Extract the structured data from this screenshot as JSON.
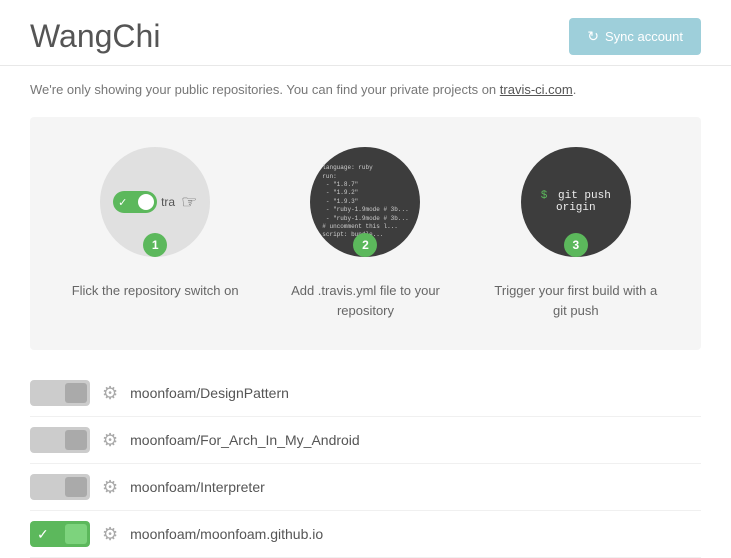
{
  "header": {
    "title": "WangChi",
    "sync_button_label": "Sync account"
  },
  "subheader": {
    "text_before": "We're only showing your public repositories. You can find your private projects on ",
    "link_text": "travis-ci.com",
    "link_href": "https://travis-ci.com",
    "text_after": "."
  },
  "steps": [
    {
      "number": "1",
      "label": "Flick the repository switch on",
      "type": "toggle"
    },
    {
      "number": "2",
      "label": "Add .travis.yml file to your repository",
      "type": "code"
    },
    {
      "number": "3",
      "label": "Trigger your first build with a git push",
      "type": "terminal"
    }
  ],
  "code_content": "language: ruby\nrun:\n  - \"1.8.7\"\n  - \"1.9.2\"\n  - \"1.9.3\"\n  - \"ruby-1.9node # 3b...\"\n  - \"ruby-1.9node # 3b...\"\n# uncomment this l...\nscript: bundle...",
  "terminal_content": "$ git push origin",
  "repositories": [
    {
      "name": "moonfoam/DesignPattern",
      "enabled": false
    },
    {
      "name": "moonfoam/For_Arch_In_My_Android",
      "enabled": false
    },
    {
      "name": "moonfoam/Interpreter",
      "enabled": false
    },
    {
      "name": "moonfoam/moonfoam.github.io",
      "enabled": true
    }
  ],
  "colors": {
    "green": "#5cb85c",
    "teal": "#9ecfda",
    "dark_bg": "#3d3d3d",
    "light_bg": "#f5f5f5"
  }
}
